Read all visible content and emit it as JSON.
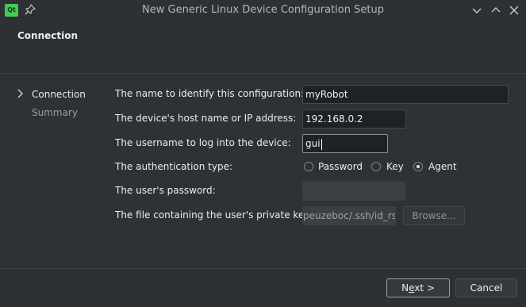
{
  "window": {
    "title": "New Generic Linux Device Configuration Setup",
    "app_logo_text": "Qt"
  },
  "header": {
    "title": "Connection"
  },
  "steps": [
    {
      "label": "Connection",
      "active": true
    },
    {
      "label": "Summary",
      "active": false
    }
  ],
  "form": {
    "name_label": "The name to identify this configuration:",
    "name_value": "myRobot",
    "host_label": "The device's host name or IP address:",
    "host_value": "192.168.0.2",
    "user_label": "The username to log into the device:",
    "user_value": "gui",
    "auth_label": "The authentication type:",
    "auth_options": [
      "Password",
      "Key",
      "Agent"
    ],
    "auth_selected": "Agent",
    "password_label": "The user's password:",
    "password_value": "",
    "keyfile_label": "The file containing the user's private key:",
    "keyfile_value": "peuzeboc/.ssh/id_rsa",
    "browse_label": "Browse..."
  },
  "footer": {
    "next_prefix": "N",
    "next_underlined": "e",
    "next_suffix": "xt >",
    "cancel_label": "Cancel"
  }
}
